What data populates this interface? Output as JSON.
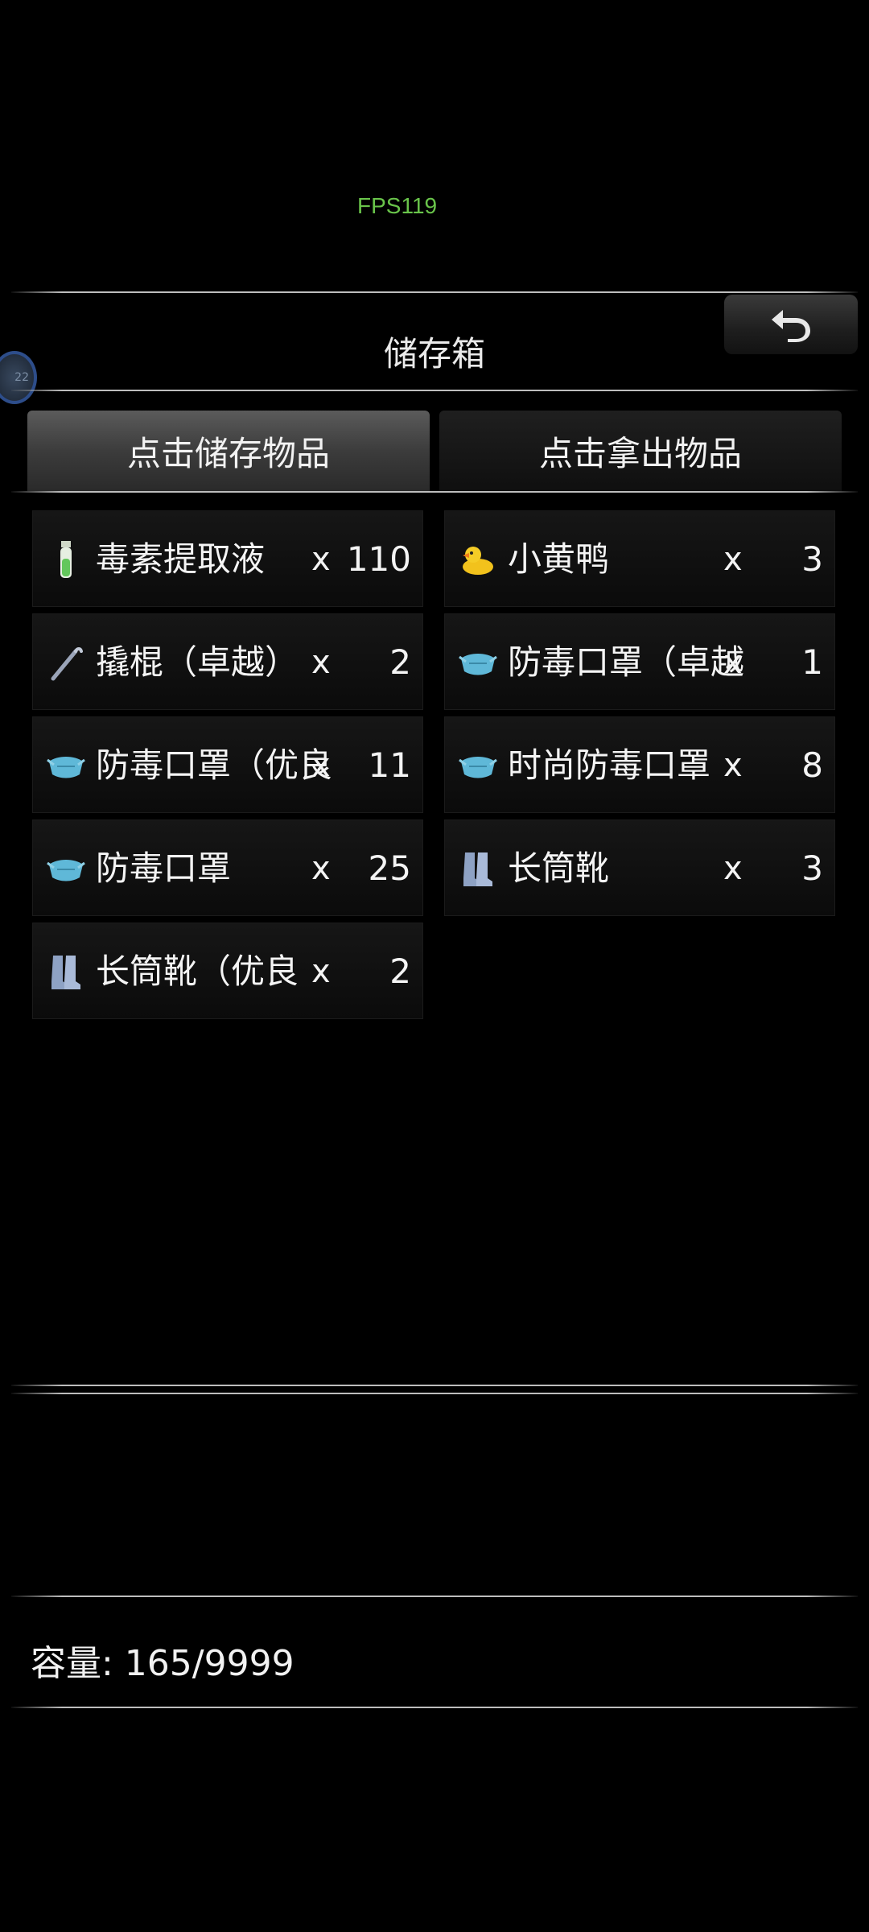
{
  "overlay": {
    "fps": "FPS119",
    "badge": "22"
  },
  "header": {
    "title": "储存箱"
  },
  "tabs": [
    {
      "label": "点击储存物品",
      "active": true
    },
    {
      "label": "点击拿出物品",
      "active": false
    }
  ],
  "items": [
    {
      "icon": "toxin-vial-icon",
      "name": "毒素提取液",
      "x": "x",
      "count": "110"
    },
    {
      "icon": "rubber-duck-icon",
      "name": "小黄鸭",
      "x": "x",
      "count": "3"
    },
    {
      "icon": "crowbar-icon",
      "name": "撬棍（卓越）",
      "x": "x",
      "count": "2"
    },
    {
      "icon": "gas-mask-icon",
      "name": "防毒口罩（卓越",
      "x": "x",
      "count": "1"
    },
    {
      "icon": "gas-mask-icon",
      "name": "防毒口罩（优良",
      "x": "x",
      "count": "11"
    },
    {
      "icon": "gas-mask-icon",
      "name": "时尚防毒口罩",
      "x": "x",
      "count": "8"
    },
    {
      "icon": "gas-mask-icon",
      "name": "防毒口罩",
      "x": "x",
      "count": "25"
    },
    {
      "icon": "boots-icon",
      "name": "长筒靴",
      "x": "x",
      "count": "3"
    },
    {
      "icon": "boots-icon",
      "name": "长筒靴（优良",
      "x": "x",
      "count": "2"
    }
  ],
  "footer": {
    "capacity": "容量: 165/9999"
  },
  "colors": {
    "fps": "#69c44a",
    "background": "#000000",
    "tab_active": "#4a4a4a"
  }
}
